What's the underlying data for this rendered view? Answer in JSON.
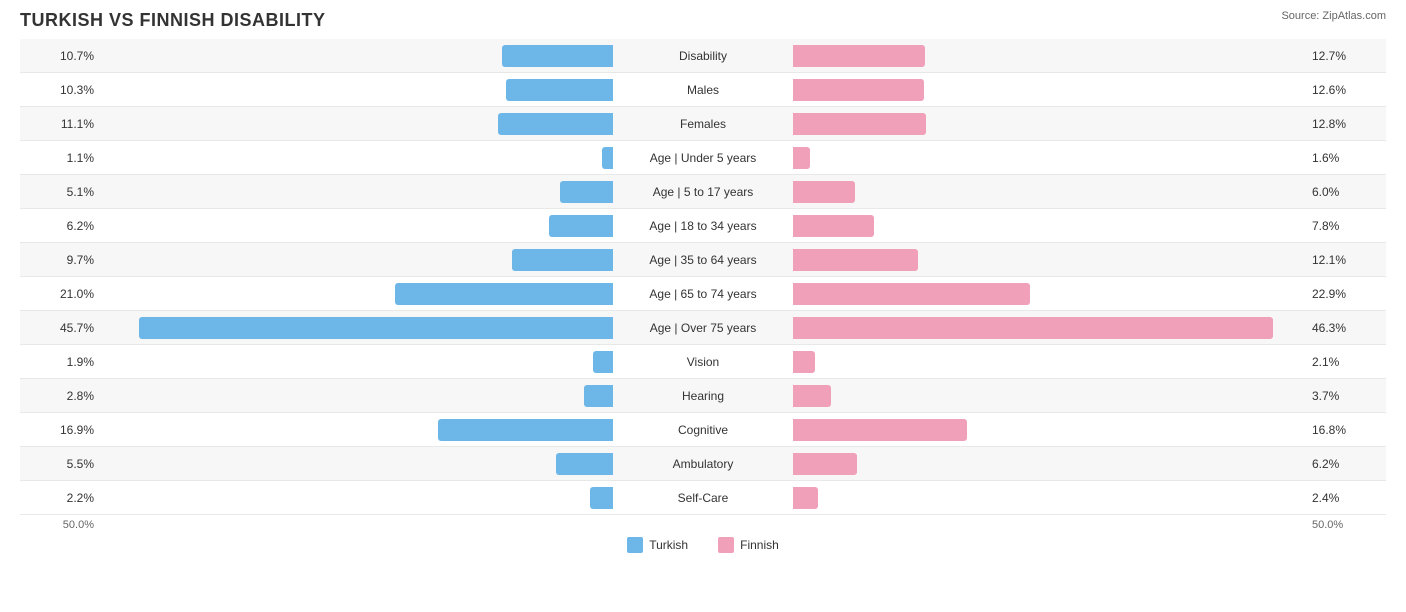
{
  "title": "TURKISH VS FINNISH DISABILITY",
  "source": "Source: ZipAtlas.com",
  "axis_left": "50.0%",
  "axis_right": "50.0%",
  "legend": {
    "turkish_label": "Turkish",
    "finnish_label": "Finnish"
  },
  "rows": [
    {
      "label": "Disability",
      "left_val": "10.7%",
      "left_pct": 21.4,
      "right_val": "12.7%",
      "right_pct": 25.4
    },
    {
      "label": "Males",
      "left_val": "10.3%",
      "left_pct": 20.6,
      "right_val": "12.6%",
      "right_pct": 25.2
    },
    {
      "label": "Females",
      "left_val": "11.1%",
      "left_pct": 22.2,
      "right_val": "12.8%",
      "right_pct": 25.6
    },
    {
      "label": "Age | Under 5 years",
      "left_val": "1.1%",
      "left_pct": 2.2,
      "right_val": "1.6%",
      "right_pct": 3.2
    },
    {
      "label": "Age | 5 to 17 years",
      "left_val": "5.1%",
      "left_pct": 10.2,
      "right_val": "6.0%",
      "right_pct": 12.0
    },
    {
      "label": "Age | 18 to 34 years",
      "left_val": "6.2%",
      "left_pct": 12.4,
      "right_val": "7.8%",
      "right_pct": 15.6
    },
    {
      "label": "Age | 35 to 64 years",
      "left_val": "9.7%",
      "left_pct": 19.4,
      "right_val": "12.1%",
      "right_pct": 24.2
    },
    {
      "label": "Age | 65 to 74 years",
      "left_val": "21.0%",
      "left_pct": 42.0,
      "right_val": "22.9%",
      "right_pct": 45.8
    },
    {
      "label": "Age | Over 75 years",
      "left_val": "45.7%",
      "left_pct": 91.4,
      "right_val": "46.3%",
      "right_pct": 92.6
    },
    {
      "label": "Vision",
      "left_val": "1.9%",
      "left_pct": 3.8,
      "right_val": "2.1%",
      "right_pct": 4.2
    },
    {
      "label": "Hearing",
      "left_val": "2.8%",
      "left_pct": 5.6,
      "right_val": "3.7%",
      "right_pct": 7.4
    },
    {
      "label": "Cognitive",
      "left_val": "16.9%",
      "left_pct": 33.8,
      "right_val": "16.8%",
      "right_pct": 33.6
    },
    {
      "label": "Ambulatory",
      "left_val": "5.5%",
      "left_pct": 11.0,
      "right_val": "6.2%",
      "right_pct": 12.4
    },
    {
      "label": "Self-Care",
      "left_val": "2.2%",
      "left_pct": 4.4,
      "right_val": "2.4%",
      "right_pct": 4.8
    }
  ]
}
